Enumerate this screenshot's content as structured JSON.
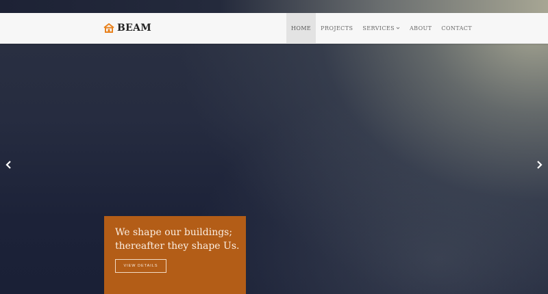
{
  "brand": {
    "name": "BEAM",
    "icon": "house-icon",
    "accent_color": "#e8821e"
  },
  "nav": {
    "items": [
      {
        "label": "HOME",
        "active": true
      },
      {
        "label": "PROJECTS",
        "active": false
      },
      {
        "label": "SERVICES",
        "active": false,
        "has_dropdown": true
      },
      {
        "label": "ABOUT",
        "active": false
      },
      {
        "label": "CONTACT",
        "active": false
      }
    ]
  },
  "slider": {
    "prev_icon": "chevron-left-icon",
    "next_icon": "chevron-right-icon"
  },
  "hero": {
    "caption": "We shape our buildings; thereafter they shape Us.",
    "button_label": "VIEW DETAILS",
    "caption_bg_color": "#b35d17"
  }
}
